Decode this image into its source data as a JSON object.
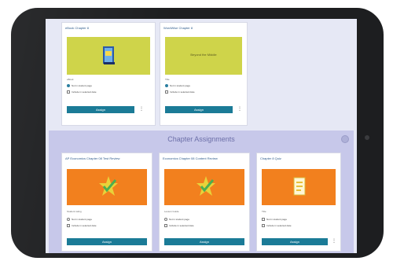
{
  "top_cards": [
    {
      "title": "eBook Chapter 8",
      "meta": "eBook",
      "opt1": "Not in student page",
      "opt2": "Include in selected date",
      "button": "Assign",
      "thumb": "green",
      "icon": "book-icon"
    },
    {
      "title": "WordWise Chapter 8",
      "meta": "Title",
      "opt1": "Not in student page",
      "opt2": "Include in selected date",
      "button": "Assign",
      "thumb": "green",
      "thumb_text": "Beyond the Middle",
      "icon": "none"
    }
  ],
  "section": {
    "title": "Chapter Assignments",
    "cards": [
      {
        "title": "AP Economics Chapter 08 Test Review",
        "meta": "Student rating",
        "opt1": "Not in student page",
        "opt2": "Include in selected date",
        "button": "Assign",
        "icon": "star-check-icon"
      },
      {
        "title": "Economics Chapter 08 Content Review",
        "meta": "Lesson Guide",
        "opt1": "Not in student page",
        "opt2": "Include in selected date",
        "button": "Assign",
        "icon": "star-check-icon"
      },
      {
        "title": "Chapter 8 Quiz",
        "meta": "Title",
        "opt1": "Not in student page",
        "opt2": "Include in selected date",
        "button": "Assign",
        "icon": "document-icon"
      }
    ]
  },
  "colors": {
    "accent": "#1b7b97",
    "section_bg": "#c7c8ea",
    "green": "#cfd44a",
    "orange": "#f2801e"
  }
}
